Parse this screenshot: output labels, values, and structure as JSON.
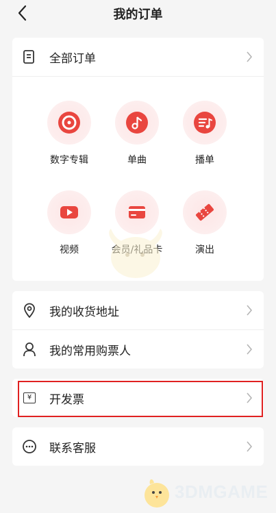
{
  "header": {
    "title": "我的订单"
  },
  "all_orders": {
    "label": "全部订单"
  },
  "grid": [
    {
      "label": "数字专辑",
      "icon": "vinyl-icon"
    },
    {
      "label": "单曲",
      "icon": "music-note-icon"
    },
    {
      "label": "播单",
      "icon": "playlist-icon"
    },
    {
      "label": "视频",
      "icon": "play-video-icon"
    },
    {
      "label": "会员/礼品卡",
      "icon": "card-icon"
    },
    {
      "label": "演出",
      "icon": "ticket-icon"
    }
  ],
  "menu": {
    "address": "我的收货地址",
    "buyer": "我的常用购票人",
    "invoice": "开发票",
    "invoice_icon_text": "¥",
    "service": "联系客服"
  },
  "watermark": {
    "text": "3DMGAME"
  },
  "colors": {
    "accent": "#e9463f",
    "highlight": "#e02020"
  }
}
